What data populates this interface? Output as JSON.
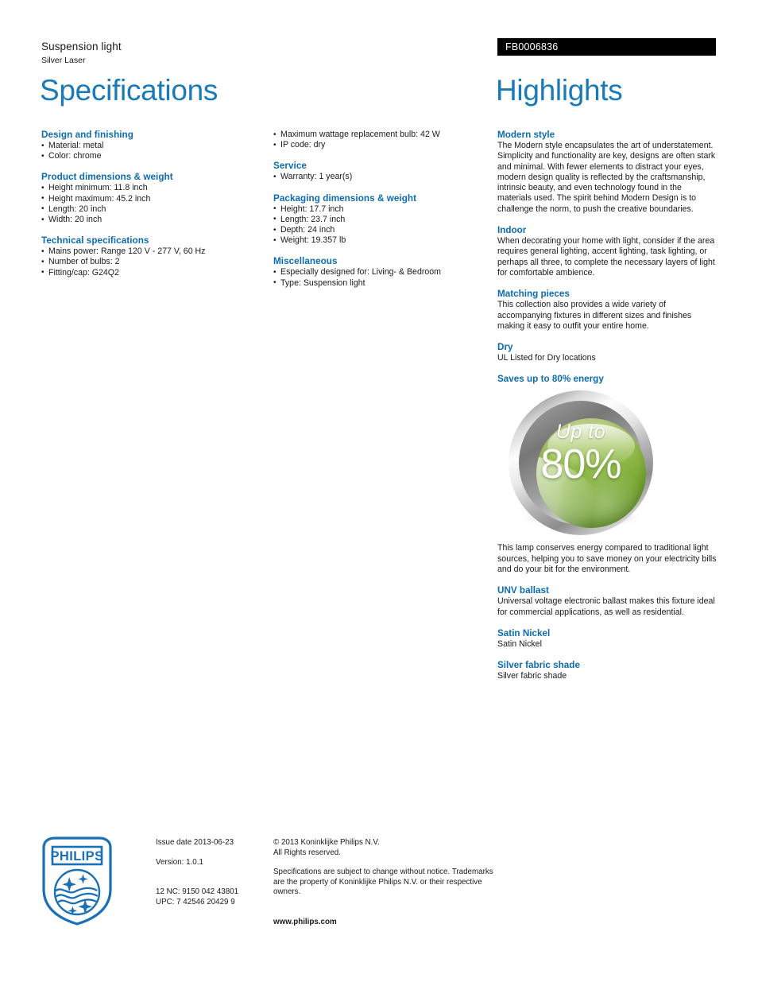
{
  "header": {
    "product_type": "Suspension light",
    "product_name": "Silver Laser",
    "product_code": "FB0006836",
    "specifications_title": "Specifications",
    "highlights_title": "Highlights"
  },
  "specifications": {
    "column_left": [
      {
        "heading": "Design and finishing",
        "items": [
          "Material: metal",
          "Color: chrome"
        ]
      },
      {
        "heading": "Product dimensions & weight",
        "items": [
          "Height minimum: 11.8 inch",
          "Height maximum: 45.2 inch",
          "Length: 20 inch",
          "Width: 20 inch"
        ]
      },
      {
        "heading": "Technical specifications",
        "items": [
          "Mains power: Range 120 V - 277 V, 60 Hz",
          "Number of bulbs: 2",
          "Fitting/cap: G24Q2"
        ]
      }
    ],
    "column_mid": [
      {
        "heading": "",
        "items": [
          "Maximum wattage replacement bulb: 42 W",
          "IP code: dry"
        ]
      },
      {
        "heading": "Service",
        "items": [
          "Warranty: 1 year(s)"
        ]
      },
      {
        "heading": "Packaging dimensions & weight",
        "items": [
          "Height: 17.7 inch",
          "Length: 23.7 inch",
          "Depth: 24 inch",
          "Weight: 19.357 lb"
        ]
      },
      {
        "heading": "Miscellaneous",
        "items": [
          "Especially designed for: Living- & Bedroom",
          "Type: Suspension light"
        ]
      }
    ]
  },
  "highlights": [
    {
      "heading": "Modern style",
      "body": "The Modern style encapsulates the art of understatement. Simplicity and functionality are key, designs are often stark and minimal. With fewer elements to distract your eyes, modern design quality is reflected by the craftsmanship, intrinsic beauty, and even technology found in the materials used. The spirit behind Modern Design is to challenge the norm, to push the creative boundaries."
    },
    {
      "heading": "Indoor",
      "body": "When decorating your home with light, consider if the area requires general lighting, accent lighting, task lighting, or perhaps all three, to complete the necessary layers of light for comfortable ambience."
    },
    {
      "heading": "Matching pieces",
      "body": "This collection also provides a wide variety of accompanying fixtures in different sizes and finishes making it easy to outfit your entire home."
    },
    {
      "heading": "Dry",
      "body": "UL Listed for Dry locations"
    }
  ],
  "energy_badge": {
    "heading": "Saves up to 80% energy",
    "badge_upto_text": "Up to",
    "badge_percent_text": "80%",
    "body": "This lamp conserves energy compared to traditional light sources, helping you to save money on your electricity bills and do your bit for the environment.",
    "ring_color": "#b5b5b5",
    "face_color": "#7fae38"
  },
  "highlights_after_badge": [
    {
      "heading": "UNV ballast",
      "body": "Universal voltage electronic ballast makes this fixture ideal for commercial applications, as well as residential."
    },
    {
      "heading": "Satin Nickel",
      "body": "Satin Nickel"
    },
    {
      "heading": "Silver fabric shade",
      "body": "Silver fabric shade"
    }
  ],
  "footer": {
    "logo_wordmark": "PHILIPS",
    "issue_date": "Issue date 2013-06-23",
    "version": "Version: 1.0.1",
    "nc_code": "12 NC: 9150 042 43801",
    "upc_code": "UPC: 7 42546 20429 9",
    "copyright_line1": "© 2013 Koninklijke Philips N.V.",
    "copyright_line2": "All Rights reserved.",
    "disclaimer": "Specifications are subject to change without notice. Trademarks are the property of Koninklijke Philips N.V. or their respective owners.",
    "website": "www.philips.com"
  },
  "theme": {
    "title_blue": "#1a7ab8",
    "heading_blue": "#0d6cb0",
    "banner_black": "#000000",
    "logo_blue": "#1a6fb5"
  }
}
